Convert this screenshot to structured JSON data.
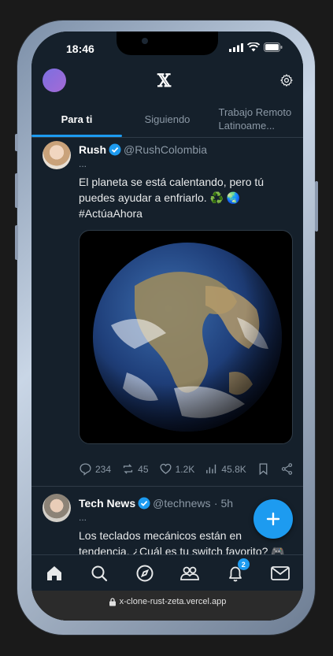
{
  "status_bar": {
    "time": "18:46"
  },
  "header": {
    "logo": "𝕏"
  },
  "tabs": [
    {
      "label": "Para ti"
    },
    {
      "label": "Siguiendo"
    },
    {
      "label": "Trabajo Remoto Latinoame..."
    }
  ],
  "tweets": [
    {
      "name": "Rush",
      "handle": "@RushColombia",
      "more": "...",
      "text_line1": "El planeta se está calentando, pero tú",
      "text_line2": "puedes ayudar a enfriarlo. ♻️ 🌏",
      "text_line3": "#ActúaAhora",
      "replies": "234",
      "retweets": "45",
      "likes": "1.2K",
      "views": "45.8K"
    },
    {
      "name": "Tech News",
      "handle": "@technews",
      "time": "· 5h",
      "more": "...",
      "text_line1": "Los teclados mecánicos están en",
      "text_line2": "tendencia. ¿Cuál es tu switch favorito? 🎮"
    }
  ],
  "bottom_nav": {
    "notifications_badge": "2"
  },
  "url_bar": {
    "url": "x-clone-rust-zeta.vercel.app"
  },
  "colors": {
    "accent": "#1d9bf0",
    "background": "#15202b",
    "border": "#2f3b47",
    "secondary_text": "#8b98a5"
  }
}
